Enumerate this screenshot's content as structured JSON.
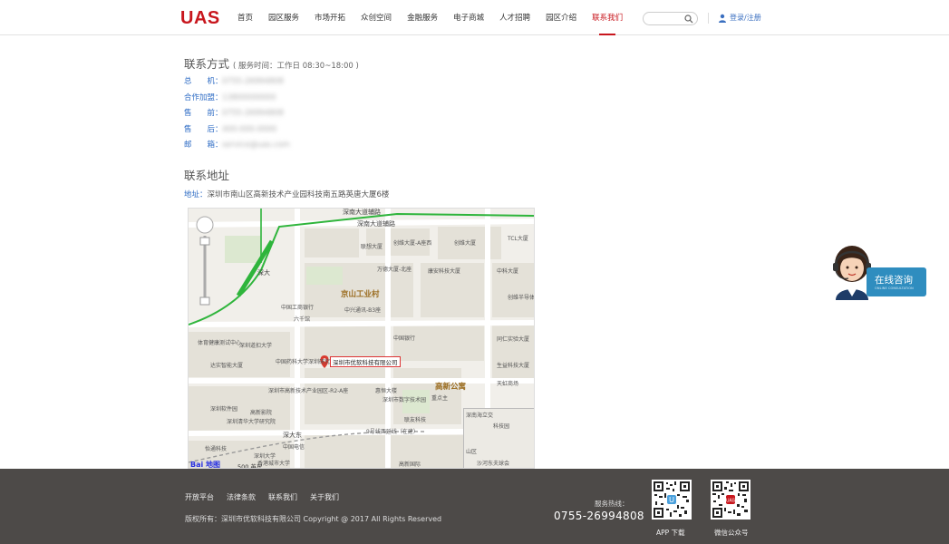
{
  "header": {
    "logo": "UAS",
    "nav": [
      "首页",
      "园区服务",
      "市场开拓",
      "众创空间",
      "金融服务",
      "电子商城",
      "人才招聘",
      "园区介绍",
      "联系我们"
    ],
    "active_index": 8,
    "search_placeholder": "",
    "login_label": "登录/注册"
  },
  "contact": {
    "title": "联系方式",
    "service_hours": "( 服务时间：工作日 08:30~18:00 )",
    "rows": [
      {
        "label": "总　　机：",
        "value": "0755-26994808"
      },
      {
        "label": "合作加盟：",
        "value": "13800000000"
      },
      {
        "label": "售　　前：",
        "value": "0755-26994808"
      },
      {
        "label": "售　　后：",
        "value": "400-000-0000"
      },
      {
        "label": "邮　　箱：",
        "value": "service@uas.com"
      }
    ]
  },
  "address": {
    "title": "联系地址",
    "label": "地址：",
    "value": "深圳市南山区高新技术产业园科技南五路英唐大厦6楼"
  },
  "map": {
    "roads": {
      "top": "深南大道辅路",
      "top2": "深南大道辅路",
      "bottom": "深大东",
      "bottom2": "9号线西延线（在建）"
    },
    "station_label": "深大",
    "area_labels": {
      "jingshan": "京山工业村",
      "gaoxin": "高新公寓"
    },
    "poi_labels": {
      "lianxiang": "联想大厦",
      "chuangwei": "创维大厦-A座西",
      "chuangwei2": "创维大厦",
      "tcl": "TCL大厦",
      "wanda": "万德大厦-北座",
      "kanggan": "康安科技大厦",
      "zhongke": "中科大厦",
      "gongshang": "中国工商银行",
      "liuqian": "六千馆",
      "chuangwei3": "创维半导体设计大厦",
      "zhongxing": "中兴通讯-B3座",
      "zhongguo": "中国银行",
      "tongren": "同仁实验大厦",
      "shengyi": "生益科技大厦",
      "tianhong": "天虹商场",
      "tiyu": "体育健康测试中心",
      "shenyan": "深圳道扣大学",
      "daxue": "中国药科大学深圳研究院",
      "dayuan": "达实智能大厦",
      "gaoxinjishu": "深圳市高新技术产业园区-R2-A座",
      "hengzhi": "惠恒大楼",
      "shuzi": "深圳市数字技术园",
      "chongdian": "重点主",
      "ruanjian": "深圳软件园",
      "qinghua": "深圳清华大学研究院",
      "gaoxin2": "高新影院",
      "shenda": "深圳大学",
      "xianggang": "香港城市大学",
      "zhongguodianxin": "中国电信",
      "lianyou": "联友科技",
      "gaoxinguoji": "高新国际",
      "yitong": "怡通科技",
      "keji": "科技园",
      "shahe": "山区",
      "shunan": "深南海立交",
      "shahe2": "沙河东夫球会"
    },
    "pin_label": "深圳市优软科技有限公司",
    "scale": "500 英尺",
    "logo": "Bai 地图"
  },
  "float_service": {
    "title": "在线咨询",
    "subtitle": "ONLINE CONSULTATION"
  },
  "footer": {
    "links": [
      "开放平台",
      "法律条款",
      "联系我们",
      "关于我们"
    ],
    "copyright": "版权所有：深圳市优软科技有限公司 Copyright @ 2017 All Rights Reserved",
    "hotline_label": "服务热线：",
    "hotline": "0755-26994808",
    "qr_captions": [
      "APP 下载",
      "微信公众号"
    ]
  },
  "colors": {
    "brand_red": "#c8161d",
    "link_blue": "#2d6bc4",
    "footer_bg": "#4d4a48",
    "float_blue": "#2f8dbf"
  }
}
